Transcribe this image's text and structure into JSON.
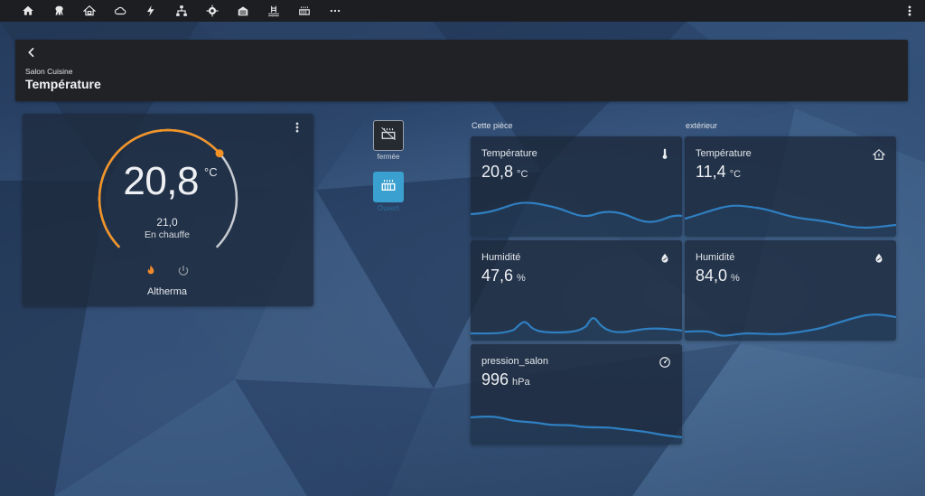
{
  "topbar": {
    "nav_icons": [
      "home-icon",
      "floor-plan-icon",
      "house-icon",
      "cloud-icon",
      "lightning-icon",
      "network-icon",
      "gear-icon",
      "garage-icon",
      "pool-icon",
      "radiator-icon",
      "more-horizontal-icon"
    ],
    "overflow_icon": "more-vertical-icon"
  },
  "header": {
    "breadcrumb": "Salon Cuisine",
    "title": "Température"
  },
  "thermostat": {
    "current_temperature": "20,8",
    "unit": "°C",
    "target_temperature": "21,0",
    "hvac_action": "En chauffe",
    "name": "Altherma",
    "heat_color": "#f39325",
    "track_color": "#c8ccd2",
    "target_fraction": 0.68
  },
  "shutters": {
    "closed_label": "fermée",
    "open_label": "Ouvert",
    "active_color": "#3aa0cf"
  },
  "sections": {
    "this_room": "Cette pièce",
    "outside": "extérieur"
  },
  "sensors": {
    "room_temperature": {
      "name": "Température",
      "value": "20,8",
      "unit": "°C",
      "icon": "thermometer-icon"
    },
    "room_humidity": {
      "name": "Humidité",
      "value": "47,6",
      "unit": "%",
      "icon": "water-percent-icon"
    },
    "pressure": {
      "name": "pression_salon",
      "value": "996",
      "unit": "hPa",
      "icon": "gauge-icon"
    },
    "outside_temperature": {
      "name": "Température",
      "value": "11,4",
      "unit": "°C",
      "icon": "home-thermometer-icon"
    },
    "outside_humidity": {
      "name": "Humidité",
      "value": "84,0",
      "unit": "%",
      "icon": "water-percent-icon"
    }
  },
  "colors": {
    "graph_line": "#2f7fc1",
    "topbar_bg": "#1c1e22",
    "card_bg": "#1c283a"
  }
}
